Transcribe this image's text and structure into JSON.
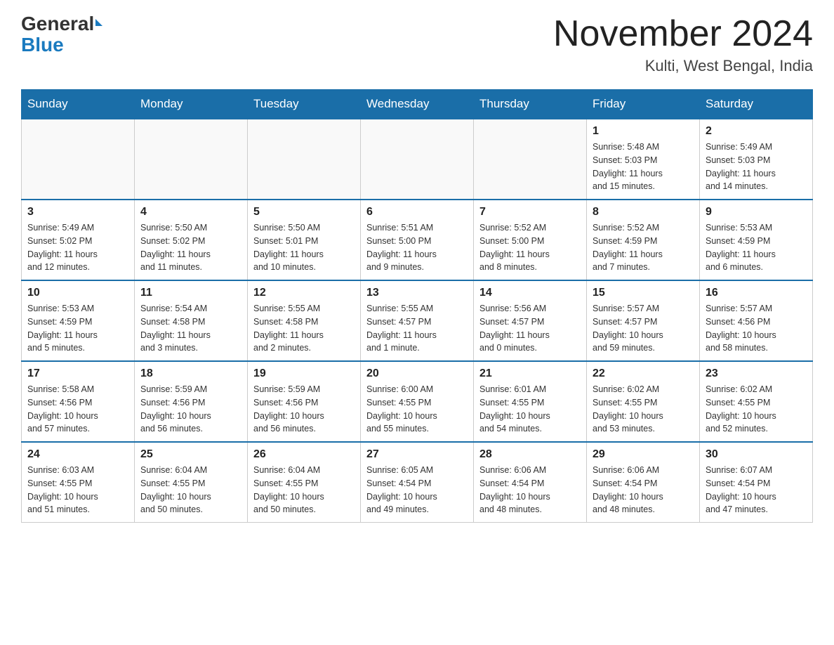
{
  "logo": {
    "general": "General",
    "blue": "Blue",
    "triangle_char": "▶"
  },
  "title": "November 2024",
  "subtitle": "Kulti, West Bengal, India",
  "days_of_week": [
    "Sunday",
    "Monday",
    "Tuesday",
    "Wednesday",
    "Thursday",
    "Friday",
    "Saturday"
  ],
  "weeks": [
    [
      {
        "day": "",
        "info": ""
      },
      {
        "day": "",
        "info": ""
      },
      {
        "day": "",
        "info": ""
      },
      {
        "day": "",
        "info": ""
      },
      {
        "day": "",
        "info": ""
      },
      {
        "day": "1",
        "info": "Sunrise: 5:48 AM\nSunset: 5:03 PM\nDaylight: 11 hours\nand 15 minutes."
      },
      {
        "day": "2",
        "info": "Sunrise: 5:49 AM\nSunset: 5:03 PM\nDaylight: 11 hours\nand 14 minutes."
      }
    ],
    [
      {
        "day": "3",
        "info": "Sunrise: 5:49 AM\nSunset: 5:02 PM\nDaylight: 11 hours\nand 12 minutes."
      },
      {
        "day": "4",
        "info": "Sunrise: 5:50 AM\nSunset: 5:02 PM\nDaylight: 11 hours\nand 11 minutes."
      },
      {
        "day": "5",
        "info": "Sunrise: 5:50 AM\nSunset: 5:01 PM\nDaylight: 11 hours\nand 10 minutes."
      },
      {
        "day": "6",
        "info": "Sunrise: 5:51 AM\nSunset: 5:00 PM\nDaylight: 11 hours\nand 9 minutes."
      },
      {
        "day": "7",
        "info": "Sunrise: 5:52 AM\nSunset: 5:00 PM\nDaylight: 11 hours\nand 8 minutes."
      },
      {
        "day": "8",
        "info": "Sunrise: 5:52 AM\nSunset: 4:59 PM\nDaylight: 11 hours\nand 7 minutes."
      },
      {
        "day": "9",
        "info": "Sunrise: 5:53 AM\nSunset: 4:59 PM\nDaylight: 11 hours\nand 6 minutes."
      }
    ],
    [
      {
        "day": "10",
        "info": "Sunrise: 5:53 AM\nSunset: 4:59 PM\nDaylight: 11 hours\nand 5 minutes."
      },
      {
        "day": "11",
        "info": "Sunrise: 5:54 AM\nSunset: 4:58 PM\nDaylight: 11 hours\nand 3 minutes."
      },
      {
        "day": "12",
        "info": "Sunrise: 5:55 AM\nSunset: 4:58 PM\nDaylight: 11 hours\nand 2 minutes."
      },
      {
        "day": "13",
        "info": "Sunrise: 5:55 AM\nSunset: 4:57 PM\nDaylight: 11 hours\nand 1 minute."
      },
      {
        "day": "14",
        "info": "Sunrise: 5:56 AM\nSunset: 4:57 PM\nDaylight: 11 hours\nand 0 minutes."
      },
      {
        "day": "15",
        "info": "Sunrise: 5:57 AM\nSunset: 4:57 PM\nDaylight: 10 hours\nand 59 minutes."
      },
      {
        "day": "16",
        "info": "Sunrise: 5:57 AM\nSunset: 4:56 PM\nDaylight: 10 hours\nand 58 minutes."
      }
    ],
    [
      {
        "day": "17",
        "info": "Sunrise: 5:58 AM\nSunset: 4:56 PM\nDaylight: 10 hours\nand 57 minutes."
      },
      {
        "day": "18",
        "info": "Sunrise: 5:59 AM\nSunset: 4:56 PM\nDaylight: 10 hours\nand 56 minutes."
      },
      {
        "day": "19",
        "info": "Sunrise: 5:59 AM\nSunset: 4:56 PM\nDaylight: 10 hours\nand 56 minutes."
      },
      {
        "day": "20",
        "info": "Sunrise: 6:00 AM\nSunset: 4:55 PM\nDaylight: 10 hours\nand 55 minutes."
      },
      {
        "day": "21",
        "info": "Sunrise: 6:01 AM\nSunset: 4:55 PM\nDaylight: 10 hours\nand 54 minutes."
      },
      {
        "day": "22",
        "info": "Sunrise: 6:02 AM\nSunset: 4:55 PM\nDaylight: 10 hours\nand 53 minutes."
      },
      {
        "day": "23",
        "info": "Sunrise: 6:02 AM\nSunset: 4:55 PM\nDaylight: 10 hours\nand 52 minutes."
      }
    ],
    [
      {
        "day": "24",
        "info": "Sunrise: 6:03 AM\nSunset: 4:55 PM\nDaylight: 10 hours\nand 51 minutes."
      },
      {
        "day": "25",
        "info": "Sunrise: 6:04 AM\nSunset: 4:55 PM\nDaylight: 10 hours\nand 50 minutes."
      },
      {
        "day": "26",
        "info": "Sunrise: 6:04 AM\nSunset: 4:55 PM\nDaylight: 10 hours\nand 50 minutes."
      },
      {
        "day": "27",
        "info": "Sunrise: 6:05 AM\nSunset: 4:54 PM\nDaylight: 10 hours\nand 49 minutes."
      },
      {
        "day": "28",
        "info": "Sunrise: 6:06 AM\nSunset: 4:54 PM\nDaylight: 10 hours\nand 48 minutes."
      },
      {
        "day": "29",
        "info": "Sunrise: 6:06 AM\nSunset: 4:54 PM\nDaylight: 10 hours\nand 48 minutes."
      },
      {
        "day": "30",
        "info": "Sunrise: 6:07 AM\nSunset: 4:54 PM\nDaylight: 10 hours\nand 47 minutes."
      }
    ]
  ]
}
